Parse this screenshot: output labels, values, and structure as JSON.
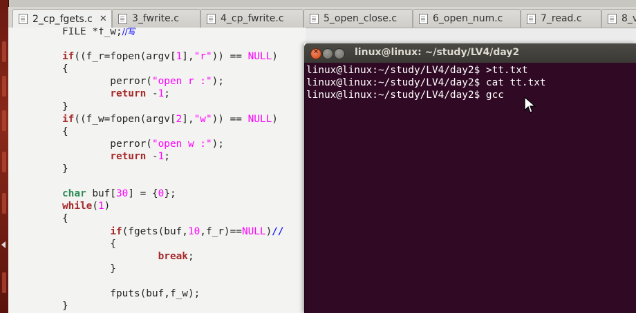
{
  "tabs": [
    {
      "label": "2_cp_fgets.c",
      "active": true,
      "close": "✕"
    },
    {
      "label": "3_fwrite.c"
    },
    {
      "label": "4_cp_fwrite.c"
    },
    {
      "label": "5_open_close.c"
    },
    {
      "label": "6_open_num.c"
    },
    {
      "label": "7_read.c"
    },
    {
      "label": "8_v"
    }
  ],
  "editor": {
    "line_1": "FILE *f_w;",
    "line_1_comment": "//写",
    "file_name": "2_cp_fgets.c"
  },
  "terminal": {
    "title": "linux@linux: ~/study/LV4/day2",
    "lines": [
      "linux@linux:~/study/LV4/day2$ >tt.txt",
      "linux@linux:~/study/LV4/day2$ cat tt.txt",
      "linux@linux:~/study/LV4/day2$ gcc"
    ],
    "background": "#300a24"
  }
}
